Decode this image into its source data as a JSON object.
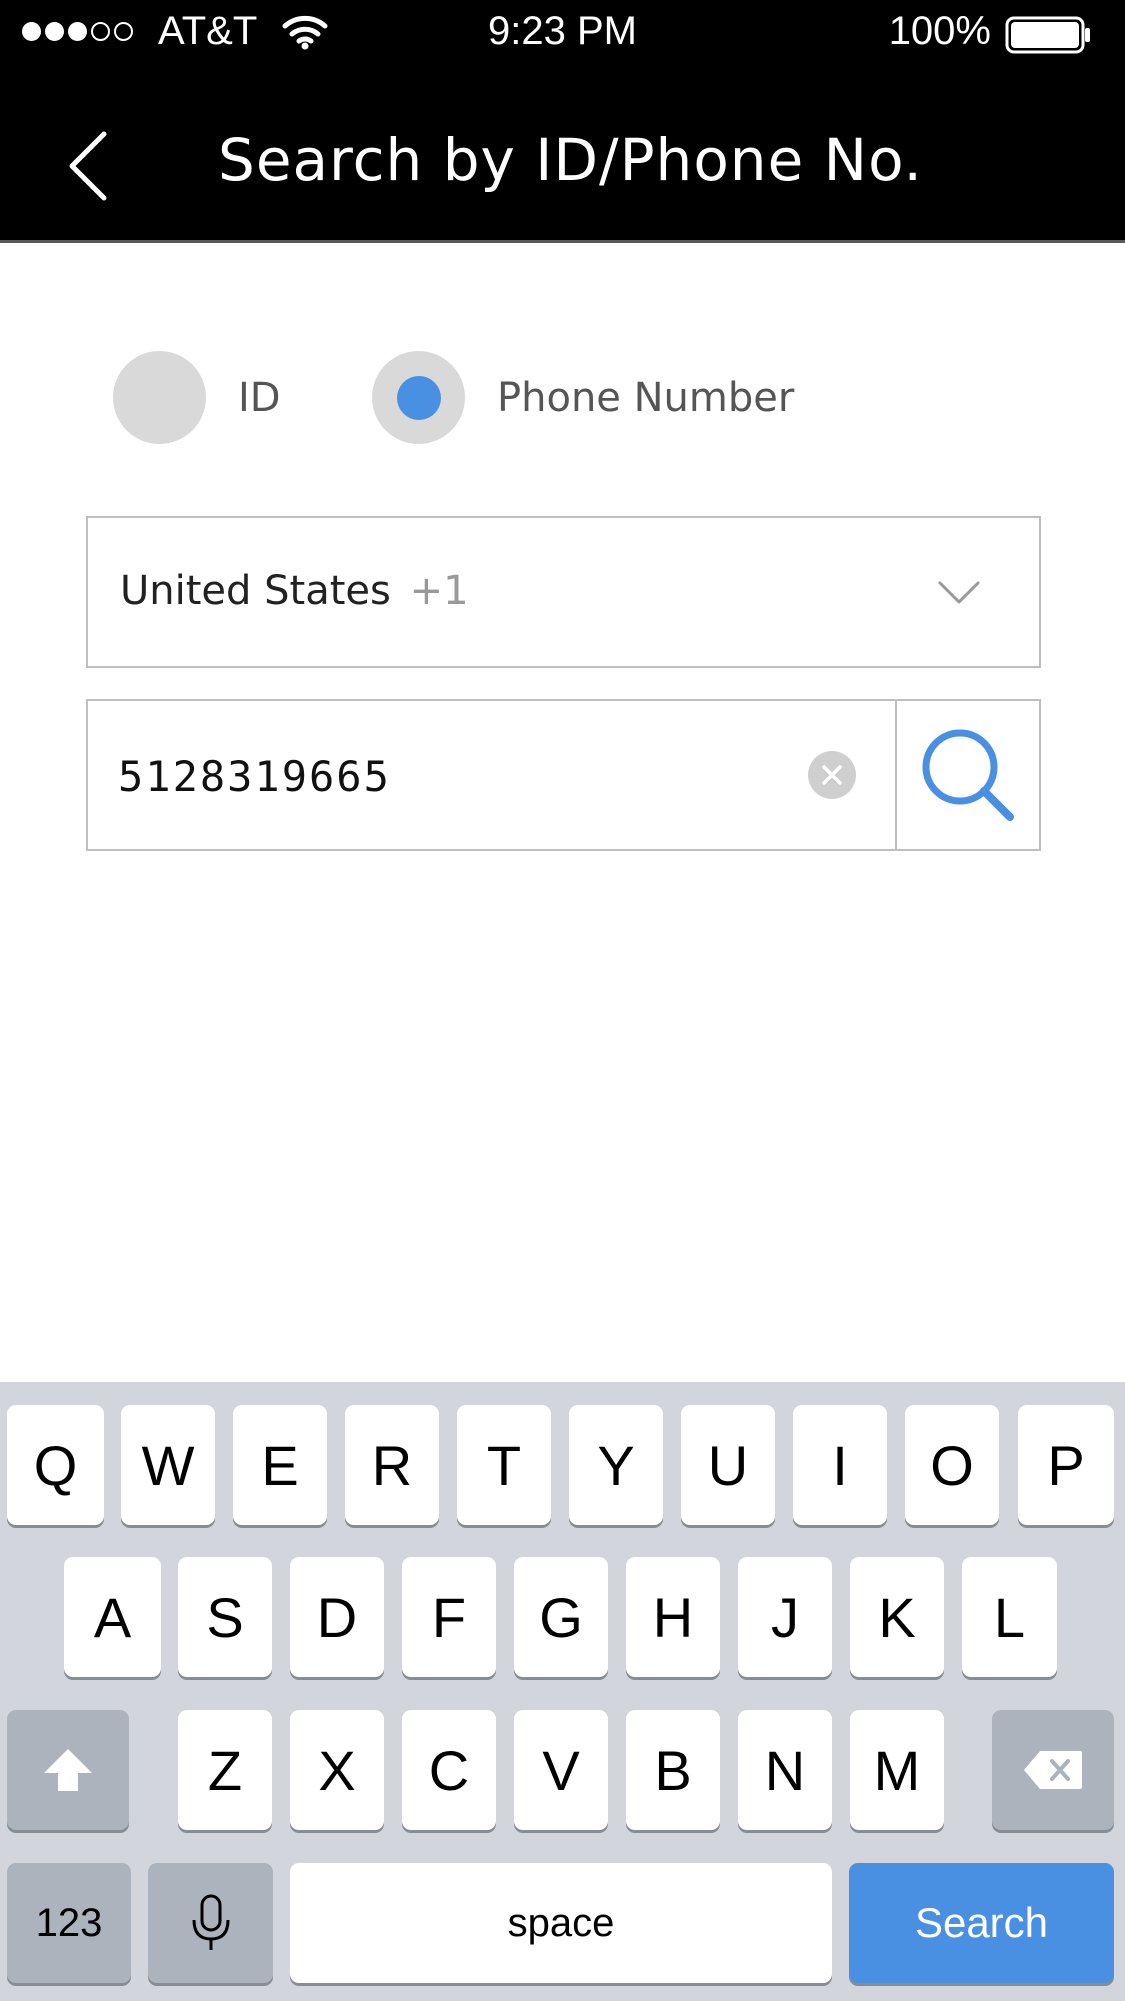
{
  "status_bar": {
    "carrier": "AT&T",
    "time": "9:23 PM",
    "battery": "100%",
    "signal_bars_filled": 3,
    "signal_bars_total": 5
  },
  "nav": {
    "title": "Search by ID/Phone No."
  },
  "search_type": {
    "options": [
      {
        "label": "ID",
        "selected": false
      },
      {
        "label": "Phone Number",
        "selected": true
      }
    ]
  },
  "country": {
    "name": "United States",
    "code": "+1"
  },
  "phone_input": {
    "value": "5128319665"
  },
  "keyboard": {
    "row1": [
      "Q",
      "W",
      "E",
      "R",
      "T",
      "Y",
      "U",
      "I",
      "O",
      "P"
    ],
    "row2": [
      "A",
      "S",
      "D",
      "F",
      "G",
      "H",
      "J",
      "K",
      "L"
    ],
    "row3": [
      "Z",
      "X",
      "C",
      "V",
      "B",
      "N",
      "M"
    ],
    "numbers_key": "123",
    "space_key": "space",
    "return_key": "Search"
  },
  "colors": {
    "accent": "#4a90e2",
    "header_bg": "#000000",
    "keyboard_bg": "#d2d5db"
  }
}
